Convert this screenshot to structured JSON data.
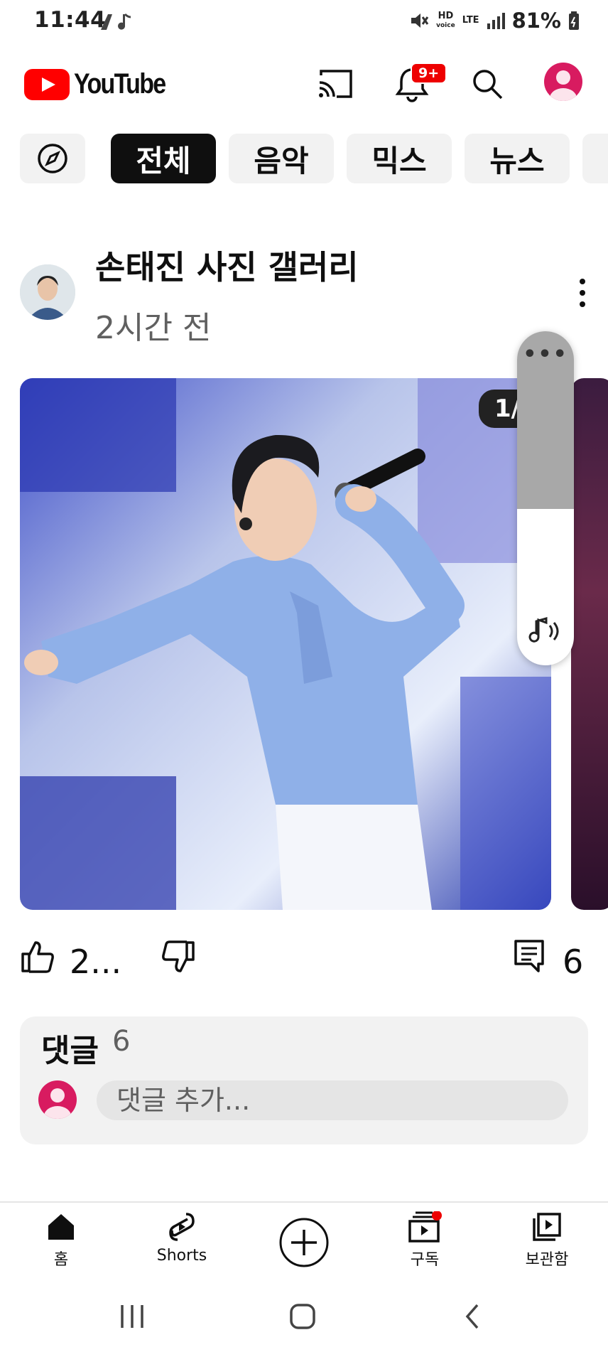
{
  "status_bar": {
    "time": "11:44",
    "battery": "81%",
    "network": "LTE",
    "hd_label": "HD",
    "voice_label": "voice"
  },
  "header": {
    "app_name": "YouTube",
    "notification_badge": "9+",
    "accent": "#ff0000"
  },
  "chips": [
    {
      "label": "",
      "icon": "explore-icon"
    },
    {
      "label": "전체",
      "active": true
    },
    {
      "label": "음악"
    },
    {
      "label": "믹스"
    },
    {
      "label": "뉴스"
    }
  ],
  "post": {
    "channel_name": "손태진 사진 갤러리",
    "time_ago": "2시간 전",
    "image_counter": "1/5",
    "likes": "2...",
    "comments": "6"
  },
  "comments_section": {
    "title": "댓글",
    "count": "6",
    "placeholder": "댓글 추가..."
  },
  "bottom_nav": [
    {
      "label": "홈",
      "icon": "home-icon"
    },
    {
      "label": "Shorts",
      "icon": "shorts-icon"
    },
    {
      "label": "",
      "icon": "create-icon"
    },
    {
      "label": "구독",
      "icon": "subscriptions-icon"
    },
    {
      "label": "보관함",
      "icon": "library-icon"
    }
  ]
}
